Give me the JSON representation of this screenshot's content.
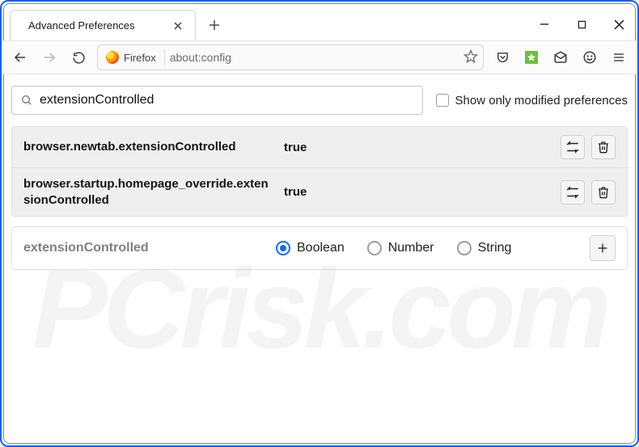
{
  "tab": {
    "title": "Advanced Preferences"
  },
  "urlbar": {
    "identity_label": "Firefox",
    "url": "about:config"
  },
  "search": {
    "query": "extensionControlled",
    "checkbox_label": "Show only modified preferences"
  },
  "prefs": [
    {
      "name": "browser.newtab.extensionControlled",
      "value": "true"
    },
    {
      "name": "browser.startup.homepage_override.extensionControlled",
      "value": "true"
    }
  ],
  "newpref": {
    "name": "extensionControlled",
    "types": [
      {
        "label": "Boolean",
        "selected": true
      },
      {
        "label": "Number",
        "selected": false
      },
      {
        "label": "String",
        "selected": false
      }
    ]
  },
  "watermark": "PCrisk.com"
}
